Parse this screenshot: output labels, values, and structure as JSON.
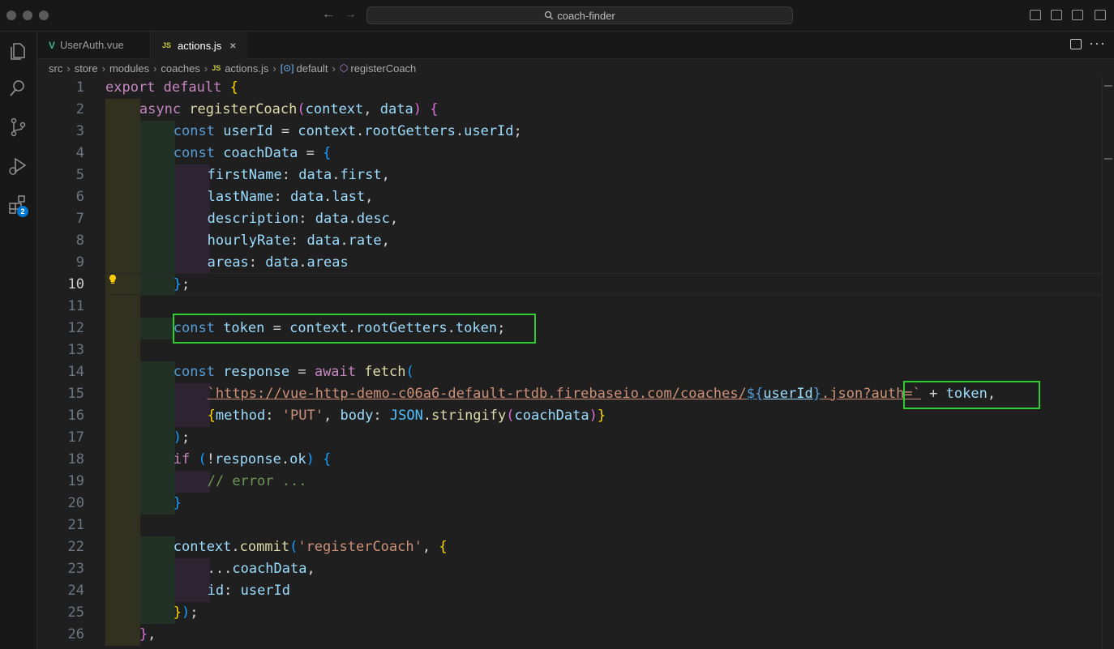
{
  "window": {
    "title": "coach-finder"
  },
  "colors": {
    "highlight": "#2ecc2e",
    "accent": "#0078d4"
  },
  "activity_bar": {
    "items": [
      "explorer-icon",
      "search-icon",
      "source-control-icon",
      "run-debug-icon",
      "extensions-icon"
    ],
    "extensions_badge": "2"
  },
  "tabs": [
    {
      "label": "UserAuth.vue",
      "icon": "V",
      "active": false
    },
    {
      "label": "actions.js",
      "icon": "JS",
      "active": true,
      "close": "×"
    }
  ],
  "breadcrumbs": [
    "src",
    "store",
    "modules",
    "coaches",
    "actions.js",
    "default",
    "registerCoach"
  ],
  "breadcrumb_js_icon": "JS",
  "editor": {
    "line_numbers": [
      "1",
      "2",
      "3",
      "4",
      "5",
      "6",
      "7",
      "8",
      "9",
      "10",
      "11",
      "12",
      "13",
      "14",
      "15",
      "16",
      "17",
      "18",
      "19",
      "20",
      "21",
      "22",
      "23",
      "24",
      "25",
      "26"
    ],
    "current_line": "10",
    "lines": [
      "export default {",
      "  async registerCoach(context, data) {",
      "    const userId = context.rootGetters.userId;",
      "    const coachData = {",
      "      firstName: data.first,",
      "      lastName: data.last,",
      "      description: data.desc,",
      "      hourlyRate: data.rate,",
      "      areas: data.areas",
      "    };",
      "",
      "    const token = context.rootGetters.token;",
      "",
      "    const response = await fetch(",
      "      `https://vue-http-demo-c06a6-default-rtdb.firebaseio.com/coaches/${userId}.json?auth=` + token,",
      "      {method: 'PUT', body: JSON.stringify(coachData)}",
      "    );",
      "    if (!response.ok) {",
      "      // error ...",
      "    }",
      "",
      "    context.commit('registerCoach', {",
      "      ...coachData,",
      "      id: userId",
      "    });",
      "  },"
    ]
  }
}
